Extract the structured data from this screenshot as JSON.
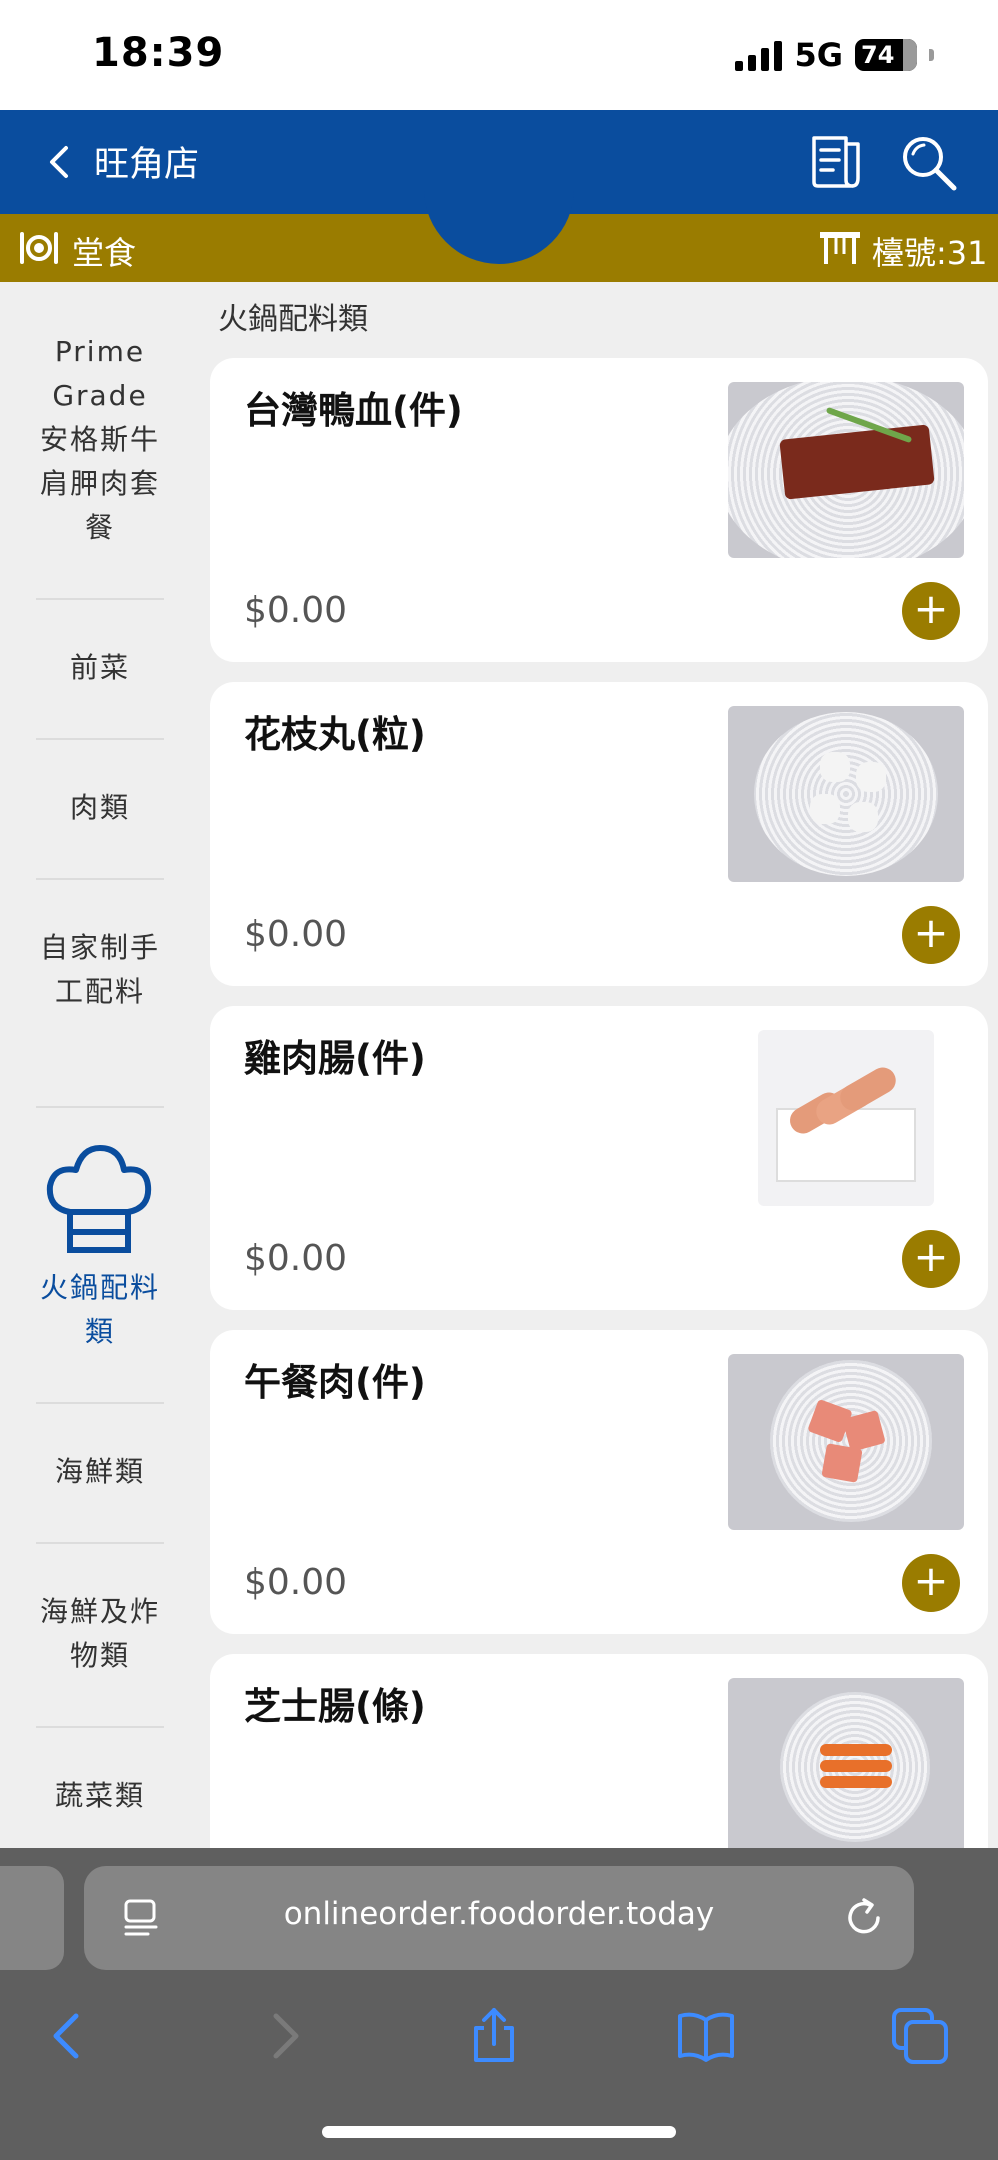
{
  "status_bar": {
    "time": "18:39",
    "network": "5G",
    "battery": "74"
  },
  "header": {
    "store_name": "旺角店"
  },
  "subbar": {
    "dine_in": "堂食",
    "table": "檯號:31"
  },
  "sidebar": {
    "items": [
      {
        "label": "Prime Grade 安格斯牛肩胛肉套餐"
      },
      {
        "label": "前菜"
      },
      {
        "label": "肉類"
      },
      {
        "label": "自家制手工配料"
      },
      {
        "label": "火鍋配料類"
      },
      {
        "label": "海鮮類"
      },
      {
        "label": "海鮮及炸物類"
      },
      {
        "label": "蔬菜類"
      }
    ],
    "active_index": 4
  },
  "main": {
    "section_title": "火鍋配料類",
    "items": [
      {
        "name": "台灣鴨血(件)",
        "price": "$0.00"
      },
      {
        "name": "花枝丸(粒)",
        "price": "$0.00"
      },
      {
        "name": "雞肉腸(件)",
        "price": "$0.00"
      },
      {
        "name": "午餐肉(件)",
        "price": "$0.00"
      },
      {
        "name": "芝士腸(條)",
        "price": ""
      }
    ],
    "add_label": "+"
  },
  "browser": {
    "url": "onlineorder.foodorder.today"
  },
  "colors": {
    "primary": "#0a4d9e",
    "accent": "#9a7c00",
    "background": "#efefef"
  }
}
